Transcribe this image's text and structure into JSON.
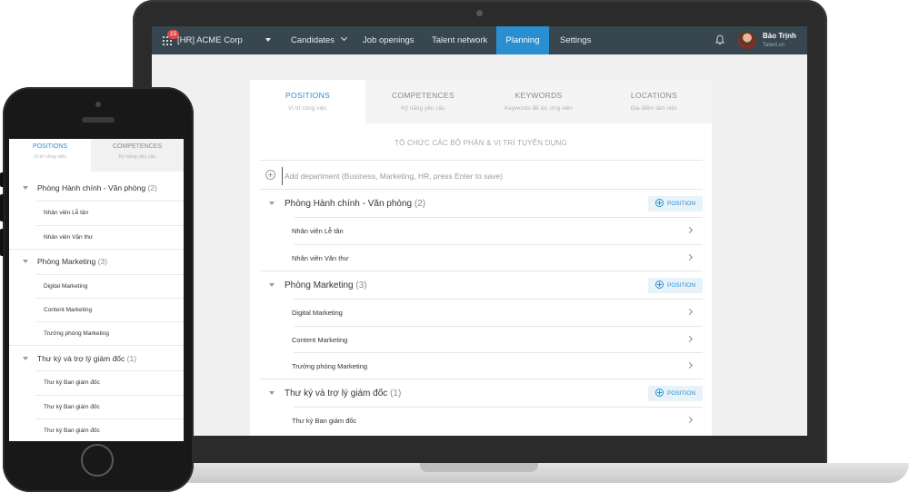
{
  "header": {
    "app_badge": "15",
    "company": "[HR] ACME Corp",
    "nav": [
      "Candidates",
      "Job openings",
      "Talent network",
      "Planning",
      "Settings"
    ],
    "active_nav": "Planning",
    "user_name": "Bảo Trịnh",
    "user_sub": "Talent.vn"
  },
  "tabs": [
    {
      "label": "POSITIONS",
      "sub": "Vị trí công việc"
    },
    {
      "label": "COMPETENCES",
      "sub": "Kỹ năng yêu cầu"
    },
    {
      "label": "KEYWORDS",
      "sub": "Keywords để lọc ứng viên"
    },
    {
      "label": "LOCATIONS",
      "sub": "Địa điểm làm việc"
    }
  ],
  "section_title": "TỔ CHỨC CÁC BỘ PHẬN & VỊ TRÍ TUYỂN DỤNG",
  "add_department_placeholder": "Add department (Business, Marketing, HR, press Enter to save)",
  "position_button_label": "POSITION",
  "departments": [
    {
      "name": "Phòng Hành chính - Văn phòng",
      "count": "(2)",
      "positions": [
        "Nhân viên Lễ tân",
        "Nhân viên Văn thư"
      ]
    },
    {
      "name": "Phòng Marketing",
      "count": "(3)",
      "positions": [
        "Digital Marketing",
        "Content Marketing",
        "Trưởng phòng Marketing"
      ]
    },
    {
      "name": "Thư ký và trợ lý giám đốc",
      "count": "(1)",
      "positions": [
        "Thư ký Ban giám đốc",
        "Thư ký Ban giám đốc",
        "Thư ký Ban giám đốc"
      ]
    }
  ],
  "colors": {
    "accent": "#2a8fd1",
    "nav_bg": "#37464f",
    "badge": "#e04848"
  },
  "icons": [
    "apps-grid-icon",
    "chevron-down-icon",
    "bell-icon",
    "plus-circle-icon",
    "triangle-down-icon",
    "chevron-right-icon"
  ]
}
